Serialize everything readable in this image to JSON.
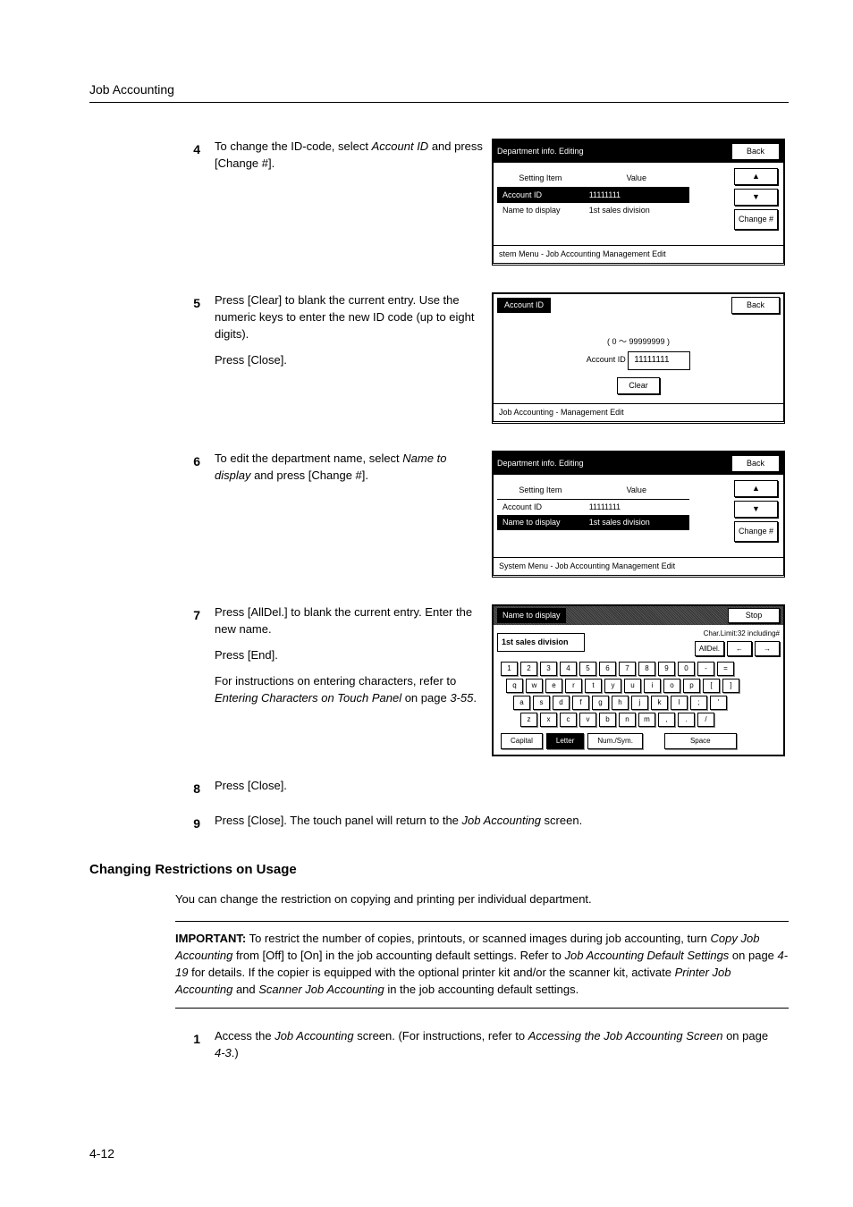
{
  "header": "Job Accounting",
  "page_number": "4-12",
  "steps": [
    {
      "num": "4",
      "text": [
        "To change the ID-code, select <i>Account ID</i> and press [Change #]."
      ]
    },
    {
      "num": "5",
      "text": [
        "Press [Clear] to blank the current entry. Use the numeric keys to enter the new ID code (up to eight digits).",
        "Press [Close]."
      ]
    },
    {
      "num": "6",
      "text": [
        "To edit the department name, select <i>Name to display</i> and press [Change #]."
      ]
    },
    {
      "num": "7",
      "text": [
        "Press [AllDel.] to blank the current entry. Enter the new name.",
        "Press [End].",
        "For instructions on entering characters, refer to <i>Entering Characters on Touch Panel</i> on page <i>3-55</i>."
      ]
    },
    {
      "num": "8",
      "text": [
        "Press [Close]."
      ]
    },
    {
      "num": "9",
      "text": [
        "Press [Close]. The touch panel will return to the <i>Job Accounting</i> screen."
      ]
    }
  ],
  "subheading": "Changing Restrictions on Usage",
  "sub_intro": "You can change the restriction on copying and printing per individual department.",
  "important": "IMPORTANT: To restrict the number of copies, printouts, or scanned images during job accounting, turn <i>Copy Job Accounting</i> from [Off] to [On] in the job accounting default settings. Refer to <i>Job Accounting Default Settings</i> on page <i>4-19</i> for details. If the copier is equipped with the optional printer kit and/or the scanner kit, activate <i>Printer Job Accounting</i> and <i>Scanner Job Accounting</i> in the job accounting default settings.",
  "sub_step": {
    "num": "1",
    "text": "Access the <i>Job Accounting</i> screen. (For instructions, refer to <i>Accessing the Job Accounting Screen</i> on page <i>4-3</i>.)"
  },
  "lcd4": {
    "title": "Department info. Editing",
    "back": "Back",
    "col1": "Setting Item",
    "col2": "Value",
    "r1c1": "Account ID",
    "r1c2": "11111111",
    "r2c1": "Name to display",
    "r2c2": "1st sales division",
    "change": "Change #",
    "foot": "stem Menu       -  Job Accounting   Management Edit"
  },
  "lcd5": {
    "title": "Account ID",
    "back": "Back",
    "range": "( 0 ～ 99999999 )",
    "label": "Account ID",
    "value": "11111111",
    "clear": "Clear",
    "foot": "Job Accounting      -  Management Edit"
  },
  "lcd6": {
    "title": "Department info. Editing",
    "back": "Back",
    "col1": "Setting Item",
    "col2": "Value",
    "r1c1": "Account ID",
    "r1c2": "11111111",
    "r2c1": "Name to display",
    "r2c2": "1st sales division",
    "change": "Change #",
    "foot": "System Menu       -  Job Accounting   Management Edit"
  },
  "kbd": {
    "title": "Name to display",
    "stop": "Stop",
    "input": "1st sales division",
    "charlimit": "Char.Limit:32 including#",
    "alldel": "AllDel.",
    "left": "←",
    "right": "→",
    "row1": [
      "1",
      "2",
      "3",
      "4",
      "5",
      "6",
      "7",
      "8",
      "9",
      "0",
      "-",
      "="
    ],
    "row2": [
      "q",
      "w",
      "e",
      "r",
      "t",
      "y",
      "u",
      "i",
      "o",
      "p",
      "[",
      "]"
    ],
    "row3": [
      "a",
      "s",
      "d",
      "f",
      "g",
      "h",
      "j",
      "k",
      "l",
      ";",
      "'"
    ],
    "row4": [
      "z",
      "x",
      "c",
      "v",
      "b",
      "n",
      "m",
      ",",
      ".",
      "/"
    ],
    "capital": "Capital",
    "letter": "Letter",
    "numsym": "Num./Sym.",
    "space": "Space"
  }
}
